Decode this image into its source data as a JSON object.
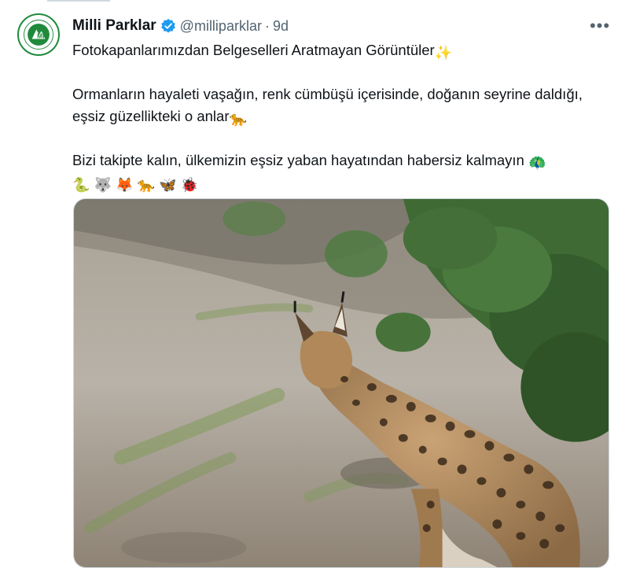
{
  "author": {
    "name": "Milli Parklar",
    "handle": "@milliparklar",
    "separator": "·",
    "time": "9d",
    "verified": true,
    "verified_color": "#1d9bf0"
  },
  "more_icon": "more-horizontal-icon",
  "more_glyph": "•••",
  "tweet": {
    "line1": "Fotokapanlarımızdan Belgeselleri Aratmayan Görüntüler",
    "line1_emoji": "✨",
    "para2": "Ormanların hayaleti vaşağın, renk cümbüşü içerisinde, doğanın seyrine daldığı, eşsiz güzellikteki o anlar",
    "para2_emoji": "🐆",
    "para3": "Bizi takipte kalın, ülkemizin eşsiz yaban hayatından habersiz kalmayın ",
    "para3_emojis": [
      "🦚",
      "🐍",
      "🐺",
      "🦊",
      "🐆",
      "🦋",
      "🐞"
    ]
  },
  "media": {
    "subject": "lynx-photo",
    "sky_color": "#cfd2cf",
    "ground_color": "#b9b2a8",
    "foliage_color": "#3f6a34",
    "lynx_color": "#b28a5e"
  }
}
